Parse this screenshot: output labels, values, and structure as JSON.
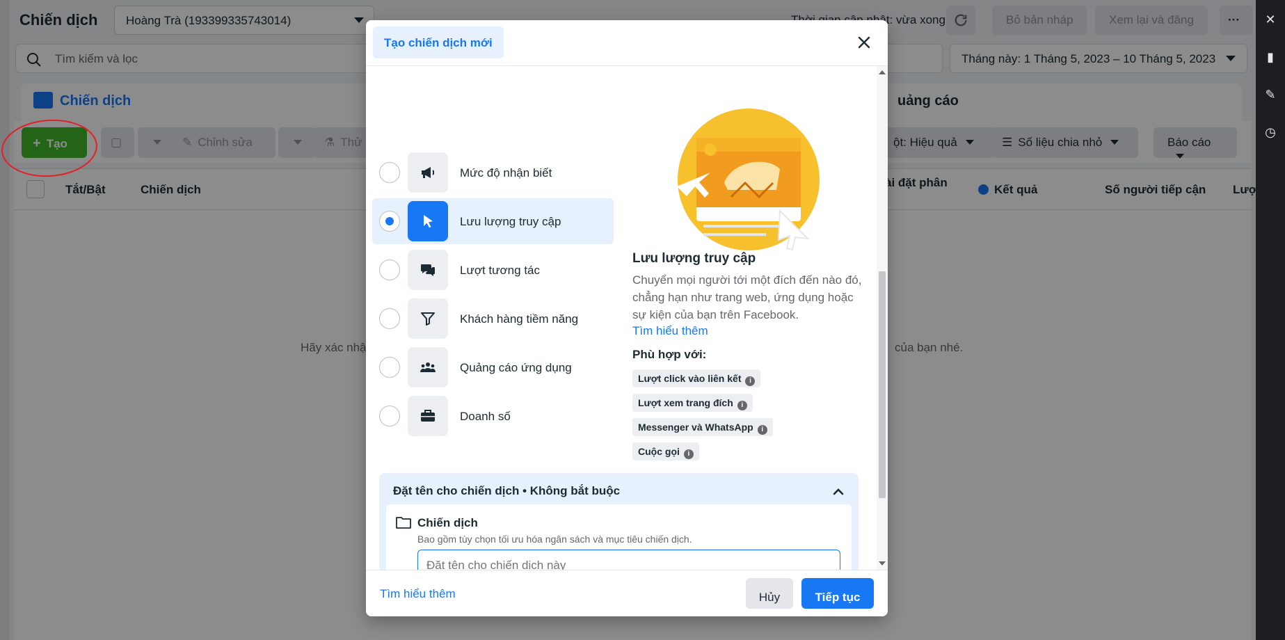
{
  "app": {
    "title": "Chiến dịch",
    "account": "Hoàng Trà (193399335743014)",
    "updated": "Thời gian cập nhật: vừa xong",
    "discard_label": "Bỏ bản nháp",
    "review_label": "Xem lại và đăng",
    "more_label": "···",
    "search_placeholder": "Tìm kiếm và lọc",
    "date_range": "Tháng này: 1 Tháng 5, 2023 – 10 Tháng 5, 2023"
  },
  "tabs": {
    "campaign": "Chiến dịch",
    "ads": "uảng cáo"
  },
  "toolbar": {
    "create": "Tạo",
    "edit": "Chỉnh sửa",
    "test": "Thử",
    "columns": "ột: Hiệu quả",
    "breakdown": "Số liệu chia nhỏ",
    "reports": "Báo cáo"
  },
  "table": {
    "headers": {
      "toggle": "Tắt/Bật",
      "campaign": "Chiến dịch",
      "settings": "ài đặt phân",
      "results": "Kết quả",
      "reach": "Số người tiếp cận",
      "impressions": "Lượ"
    },
    "empty_left": "Hãy xác nhậ",
    "empty_right": "của bạn nhé."
  },
  "modal": {
    "title": "Tạo chiến dịch mới",
    "options": [
      {
        "label": "Mức độ nhận biết",
        "icon": "megaphone-icon"
      },
      {
        "label": "Lưu lượng truy cập",
        "icon": "cursor-icon"
      },
      {
        "label": "Lượt tương tác",
        "icon": "chat-icon"
      },
      {
        "label": "Khách hàng tiềm năng",
        "icon": "funnel-icon"
      },
      {
        "label": "Quảng cáo ứng dụng",
        "icon": "people-icon"
      },
      {
        "label": "Doanh số",
        "icon": "briefcase-icon"
      }
    ],
    "selected_index": 1,
    "detail": {
      "title": "Lưu lượng truy cập",
      "description": "Chuyển mọi người tới một đích đến nào đó, chẳng hạn như trang web, ứng dụng hoặc sự kiện của bạn trên Facebook.",
      "learn_more": "Tìm hiểu thêm",
      "fit_title": "Phù hợp với:",
      "chips": [
        "Lượt click vào liên kết",
        "Lượt xem trang đích",
        "Messenger và WhatsApp",
        "Cuộc gọi"
      ]
    },
    "naming": {
      "title": "Đặt tên cho chiến dịch • Không bắt buộc",
      "card_title": "Chiến dịch",
      "card_sub": "Bao gồm tùy chọn tối ưu hóa ngân sách và mục tiêu chiến dịch.",
      "input_placeholder": "Đặt tên cho chiến dịch này",
      "input_value": ""
    },
    "footer": {
      "learn_more": "Tìm hiểu thêm",
      "cancel": "Hủy",
      "continue": "Tiếp tục"
    }
  },
  "colors": {
    "accent": "#1877f2",
    "create_green": "#42b72a",
    "annotation_red": "#e41e26"
  }
}
